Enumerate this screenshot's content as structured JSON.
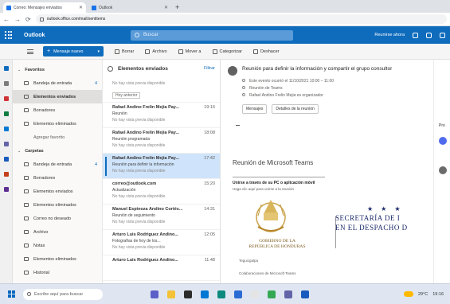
{
  "browser": {
    "tabs": [
      {
        "label": "Correo: Mensajes enviados",
        "active": true
      },
      {
        "label": "Outlook",
        "active": false
      }
    ],
    "new_tab_symbol": "+",
    "address": "outlook.office.com/mail/sentitems",
    "nav": {
      "back": "←",
      "forward": "→",
      "reload": "⟳"
    }
  },
  "suite": {
    "app_name": "Outlook",
    "search_placeholder": "Buscar",
    "meet_now": "Reunirse ahora",
    "accent": "#0f6cbd"
  },
  "ribbon": {
    "new_message": "Mensaje nuevo",
    "items": [
      "Borrar",
      "Archivo",
      "Mover a",
      "Categorizar",
      "Deshacer"
    ]
  },
  "folders": {
    "sections": [
      {
        "label": "Favoritos",
        "items": [
          {
            "label": "Bandeja de entrada",
            "count": "4"
          },
          {
            "label": "Elementos enviados",
            "count": "",
            "selected": true
          },
          {
            "label": "Borradores",
            "count": ""
          },
          {
            "label": "Elementos eliminados",
            "count": ""
          },
          {
            "label": "Agregar favorito",
            "count": "",
            "plain": true
          }
        ]
      },
      {
        "label": "Carpetas",
        "items": [
          {
            "label": "Bandeja de entrada",
            "count": "4"
          },
          {
            "label": "Borradores",
            "count": ""
          },
          {
            "label": "Elementos enviados",
            "count": ""
          },
          {
            "label": "Elementos eliminados",
            "count": ""
          },
          {
            "label": "Correo no deseado",
            "count": ""
          },
          {
            "label": "Archivo",
            "count": ""
          },
          {
            "label": "Notas",
            "count": ""
          },
          {
            "label": "Elementos eliminados",
            "count": ""
          },
          {
            "label": "Historial",
            "count": ""
          }
        ]
      }
    ]
  },
  "message_list": {
    "title": "Elementos enviados",
    "filter": "Filtrar",
    "messages": [
      {
        "from": "Elementos enviados",
        "time": "",
        "subject": "",
        "preview": "No hay vista previa disponible",
        "tag": "Hoy anterior",
        "selected": false,
        "unread": false
      },
      {
        "from": "Rafael Andino Frelin Mejia Pay...",
        "time": "19:16",
        "subject": "Reunión",
        "preview": "No hay vista previa disponible",
        "tag": "",
        "selected": false,
        "unread": false
      },
      {
        "from": "Rafael Andino Frelin Mejia Pay...",
        "time": "18:08",
        "subject": "Reunión programada",
        "preview": "No hay vista previa disponible",
        "tag": "",
        "selected": false,
        "unread": false
      },
      {
        "from": "Rafael Andino Frelin Mejia Pay...",
        "time": "17:42",
        "subject": "Reunión para definir la información",
        "preview": "No hay vista previa disponible",
        "tag": "",
        "selected": true,
        "unread": true
      },
      {
        "from": "correo@outlook.com",
        "time": "15:20",
        "subject": "Actualización",
        "preview": "No hay vista previa disponible",
        "tag": "",
        "selected": false,
        "unread": false
      },
      {
        "from": "Manuel Espinoza Andino Cortés...",
        "time": "14:31",
        "subject": "Reunión de seguimiento",
        "preview": "No hay vista previa disponible",
        "tag": "",
        "selected": false,
        "unread": false
      },
      {
        "from": "Arturo Luis Rodriguez Andino...",
        "time": "12:05",
        "subject": "Fotografías de hoy de los...",
        "preview": "No hay vista previa disponible",
        "tag": "",
        "selected": false,
        "unread": false
      },
      {
        "from": "Arturo Luis Rodriguez Andino...",
        "time": "11:48",
        "subject": "",
        "preview": "",
        "tag": "",
        "selected": false,
        "unread": false
      }
    ]
  },
  "reading": {
    "subject": "Reunión para definir la información y compartir el grupo consultor",
    "meta": [
      "Este evento ocurrió el 11/10/2021 10:00 – 11:00",
      "Reunión de Teams",
      "Rafael Andino Frelin Mejia es organizador"
    ],
    "actions": [
      "Mensajes",
      "Detalles de la reunión"
    ],
    "body_title": "Reunión de Microsoft Teams",
    "join_line": "Unirse a través de su PC o aplicación móvil",
    "join_link": "Haga clic aquí para unirse a la reunión",
    "emblem_caption_1": "GOBIERNO DE LA",
    "emblem_caption_2": "REPÚBLICA DE HONDURAS",
    "emblem_sub": "Tegucigalpa",
    "footer": "Colaboraciones de Microsoft Teams",
    "stars": "★ ★ ★",
    "secretaria_1": "SECRETARÍA DE I",
    "secretaria_2": "EN EL DESPACHO D"
  },
  "right_rail": {
    "label": "Pro"
  },
  "taskbar": {
    "search_placeholder": "Escribe aquí para buscar",
    "apps": [
      "file-explorer",
      "folder",
      "store",
      "mail",
      "edge",
      "chrome",
      "teams",
      "word",
      "excel",
      "outlook"
    ],
    "weather": "29°C",
    "time": "19:16"
  }
}
